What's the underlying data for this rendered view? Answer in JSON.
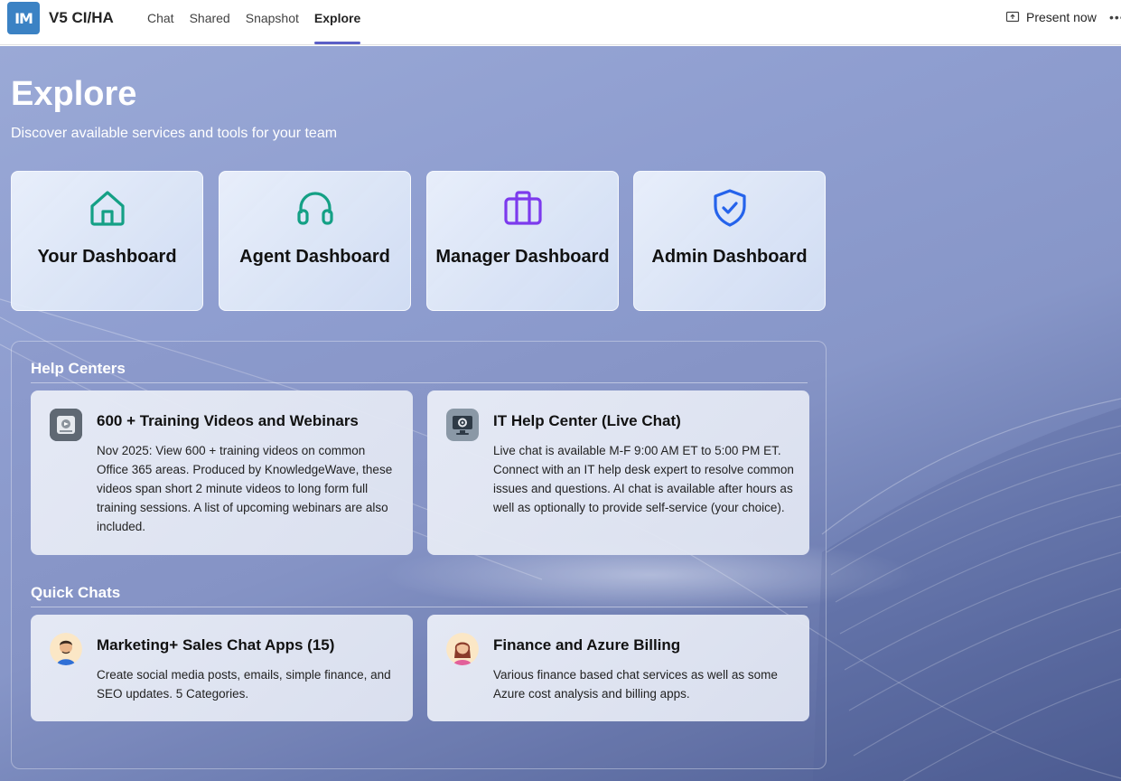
{
  "app": {
    "logo_text": "IM",
    "title": "V5 CI/HA"
  },
  "tabs": [
    {
      "label": "Chat",
      "active": false
    },
    {
      "label": "Shared",
      "active": false
    },
    {
      "label": "Snapshot",
      "active": false
    },
    {
      "label": "Explore",
      "active": true
    }
  ],
  "header_actions": {
    "present_label": "Present now",
    "more_label": "•••"
  },
  "page": {
    "title": "Explore",
    "subtitle": "Discover available services and tools for your team"
  },
  "dashboards": [
    {
      "label": "Your Dashboard",
      "icon": "home-icon",
      "color": "#14a085"
    },
    {
      "label": "Agent Dashboard",
      "icon": "headset-icon",
      "color": "#14a085"
    },
    {
      "label": "Manager Dashboard",
      "icon": "briefcase-icon",
      "color": "#7c3aed"
    },
    {
      "label": "Admin Dashboard",
      "icon": "shield-check-icon",
      "color": "#2563eb"
    }
  ],
  "help_centers": {
    "title": "Help Centers",
    "cards": [
      {
        "title": "600 + Training Videos and Webinars",
        "description": "Nov 2025: View 600 + training videos on common Office 365 areas. Produced by KnowledgeWave, these videos span short 2 minute videos to long form full training sessions. A list of upcoming webinars are also included.",
        "icon": "training-video-icon"
      },
      {
        "title": "IT Help Center (Live Chat)",
        "description": "Live chat is available M-F 9:00 AM ET to 5:00 PM ET. Connect with an IT help desk expert to resolve common issues and questions. AI chat is available after hours as well as optionally to provide self-service (your choice).",
        "icon": "monitor-gear-icon"
      }
    ]
  },
  "quick_chats": {
    "title": "Quick Chats",
    "cards": [
      {
        "title": "Marketing+ Sales Chat Apps (15)",
        "description": "Create social media posts, emails, simple finance, and SEO updates. 5 Categories.",
        "icon": "man-avatar-icon"
      },
      {
        "title": "Finance and Azure Billing",
        "description": "Various finance based chat services as well as some Azure cost analysis and billing apps.",
        "icon": "woman-avatar-icon"
      }
    ]
  },
  "colors": {
    "accent": "#5b5fc7",
    "logo_bg": "#3b82c4"
  }
}
